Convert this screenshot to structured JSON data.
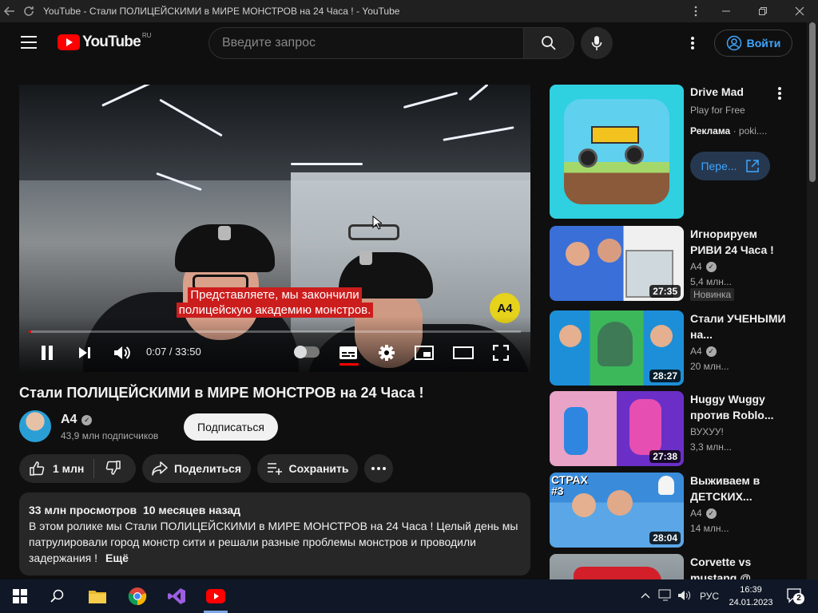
{
  "window": {
    "title": "YouTube - Стали ПОЛИЦЕЙСКИМИ в МИРЕ МОНСТРОВ на 24 Часа ! - YouTube"
  },
  "header": {
    "logo_text": "YouTube",
    "logo_region": "RU",
    "search_placeholder": "Введите запрос",
    "login_label": "Войти"
  },
  "player": {
    "subtitle_line1": "Представляете, мы закончили",
    "subtitle_line2": "полицейскую академию монстров.",
    "channel_watermark": "A4",
    "time_current": "0:07",
    "time_total": "33:50",
    "time_display": "0:07 / 33:50",
    "progress_fraction": 0.0035
  },
  "video": {
    "title": "Стали ПОЛИЦЕЙСКИМИ в МИРЕ МОНСТРОВ на 24 Часа !",
    "channel": "A4",
    "subscribers": "43,9 млн подписчиков",
    "subscribe_label": "Подписаться",
    "likes": "1 млн",
    "share_label": "Поделиться",
    "save_label": "Сохранить"
  },
  "description": {
    "meta": "33 млн просмотров  10 месяцев назад",
    "text": "В этом ролике мы Стали ПОЛИЦЕЙСКИМИ в МИРЕ МОНСТРОВ на 24 Часа ! Целый день мы патрулировали город монстр сити и решали разные проблемы монстров и проводили задержания !",
    "more_label": "Ещё"
  },
  "ad": {
    "title": "Drive Mad",
    "subtitle": "Play for Free",
    "label": "Реклама",
    "domain": "poki....",
    "button_label": "Пере..."
  },
  "recommended": [
    {
      "title": "Игнорируем РИВИ 24 Часа !",
      "channel": "A4",
      "verified": true,
      "views": "5,4 млн...",
      "duration": "27:35",
      "badge": "Новинка"
    },
    {
      "title": "Стали УЧЕНЫМИ на...",
      "channel": "A4",
      "verified": true,
      "views": "20 млн...",
      "duration": "28:27"
    },
    {
      "title": "Huggy Wuggy против Roblo...",
      "channel": "ВУХУУ!",
      "verified": false,
      "views": "3,3 млн...",
      "duration": "27:38"
    },
    {
      "title": "Выживаем в ДЕТСКИХ...",
      "channel": "A4",
      "verified": true,
      "views": "14 млн...",
      "duration": "28:04",
      "overlay": "СТРАХ\n#3"
    },
    {
      "title": "Corvette vs mustang @...",
      "channel": "",
      "verified": false,
      "views": "",
      "duration": ""
    }
  ],
  "taskbar": {
    "lang": "РУС",
    "time": "16:39",
    "date": "24.01.2023",
    "notifications": "2"
  },
  "colors": {
    "background": "#0f0f0f",
    "accent_red": "#ff0000",
    "link_blue": "#3ea6ff",
    "subtitle_bg": "#cc1d1d"
  }
}
